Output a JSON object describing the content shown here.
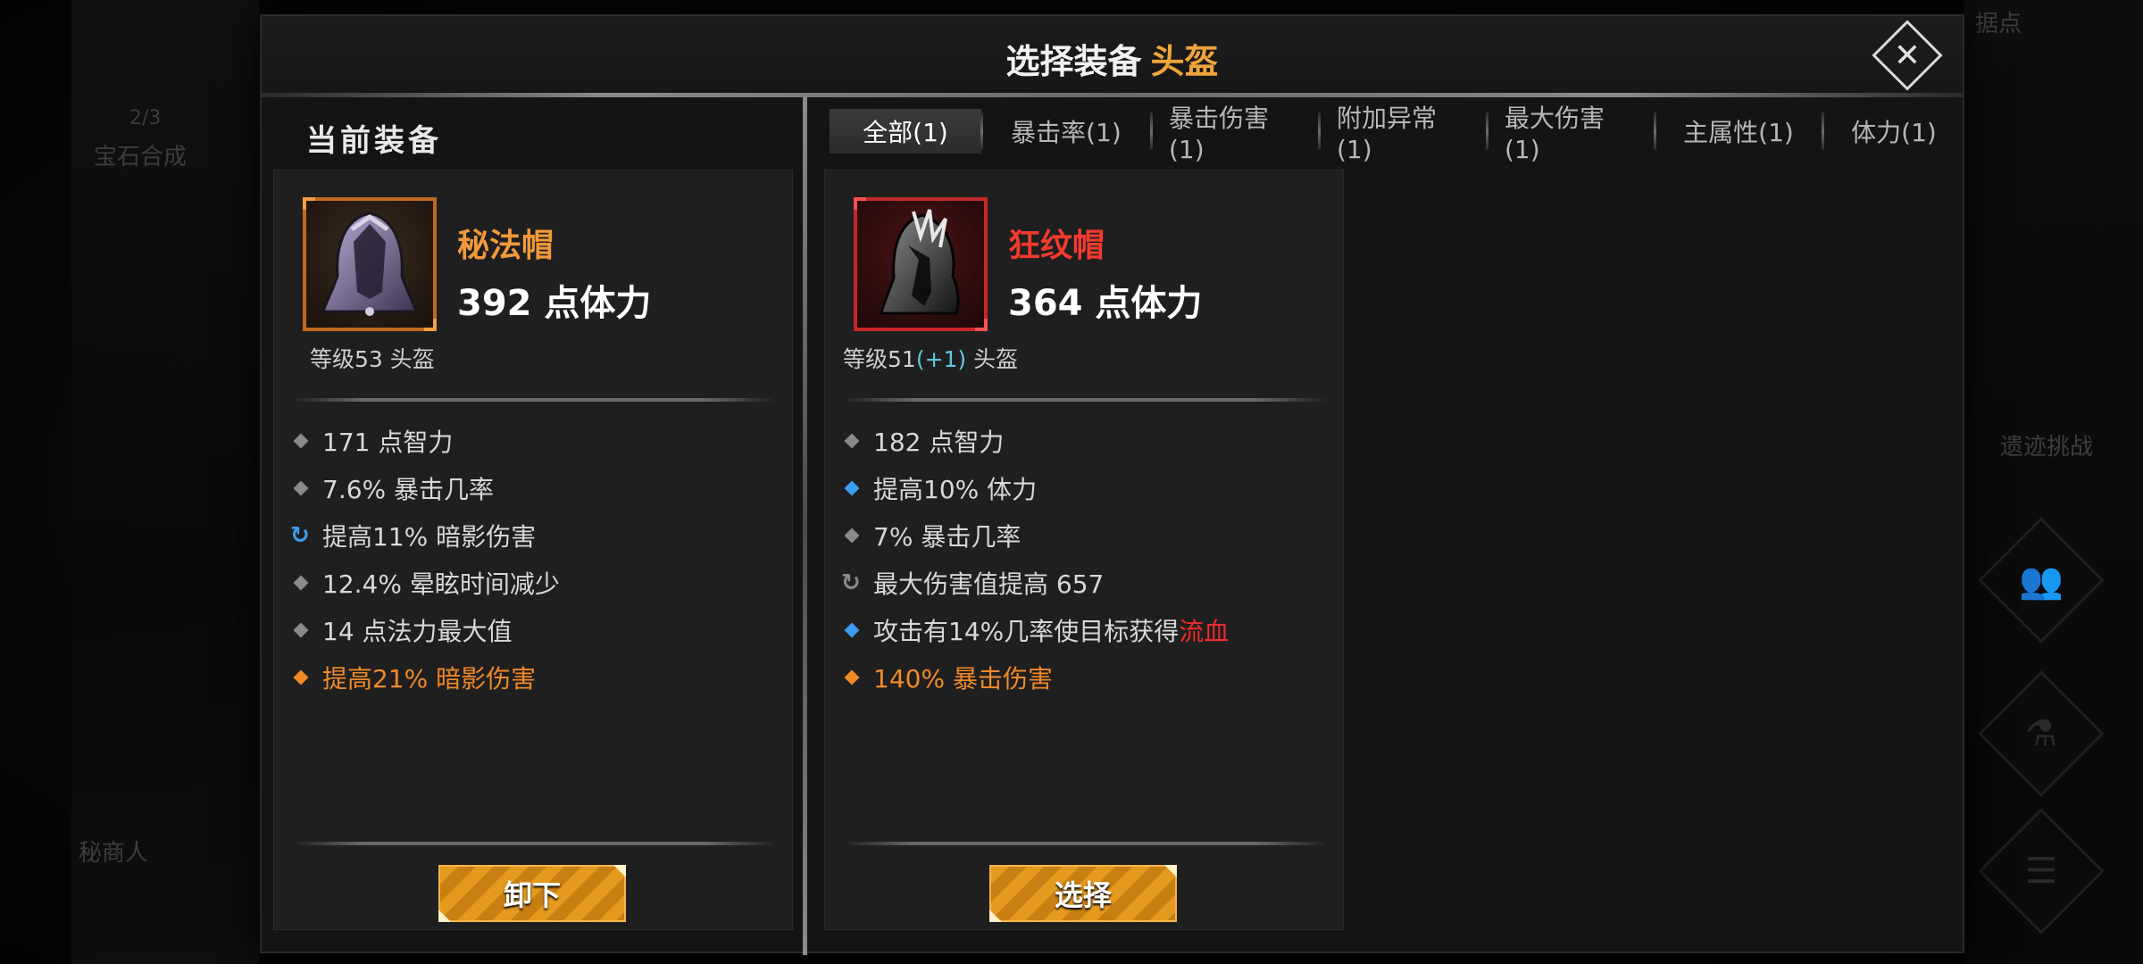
{
  "background": {
    "gem_count": "2/3",
    "gem_label": "宝石合成",
    "merchant_label": "秘商人",
    "ranking_label": "据点",
    "fight_label": "遗迹挑战"
  },
  "dialog": {
    "title": "选择装备",
    "title_slot": "头盔",
    "close_symbol": "✕"
  },
  "current": {
    "section_title": "当前装备",
    "name": "秘法帽",
    "main_stat": "392 点体力",
    "level_text": "等级53 头盔",
    "stats": [
      {
        "bullet": "gray",
        "text": "171 点智力",
        "style": "normal"
      },
      {
        "bullet": "gray",
        "text": "7.6% 暴击几率",
        "style": "normal"
      },
      {
        "bullet": "cycle-blue",
        "text": "提高11% 暗影伤害",
        "style": "normal"
      },
      {
        "bullet": "gray",
        "text": "12.4% 晕眩时间减少",
        "style": "normal"
      },
      {
        "bullet": "gray",
        "text": "14 点法力最大值",
        "style": "normal"
      },
      {
        "bullet": "orange",
        "text": "提高21% 暗影伤害",
        "style": "legend"
      }
    ],
    "button_label": "卸下"
  },
  "tabs": [
    {
      "label": "全部(1)",
      "active": true
    },
    {
      "label": "暴击率(1)",
      "active": false
    },
    {
      "label": "暴击伤害(1)",
      "active": false
    },
    {
      "label": "附加异常(1)",
      "active": false
    },
    {
      "label": "最大伤害(1)",
      "active": false
    },
    {
      "label": "主属性(1)",
      "active": false
    },
    {
      "label": "体力(1)",
      "active": false
    }
  ],
  "candidate": {
    "name": "狂纹帽",
    "main_stat": "364 点体力",
    "level_prefix": "等级51",
    "level_bonus": "(+1)",
    "level_suffix": " 头盔",
    "stats": [
      {
        "bullet": "gray",
        "text": "182 点智力",
        "style": "normal"
      },
      {
        "bullet": "blue",
        "text": "提高10% 体力",
        "style": "normal"
      },
      {
        "bullet": "gray",
        "text": "7% 暴击几率",
        "style": "normal"
      },
      {
        "bullet": "cycle-gray",
        "text": "最大伤害值提高 657",
        "style": "normal"
      },
      {
        "bullet": "blue",
        "text": "攻击有14%几率使目标获得",
        "highlight": "流血",
        "style": "normal"
      },
      {
        "bullet": "orange",
        "text": "140% 暴击伤害",
        "style": "legend"
      }
    ],
    "button_label": "选择"
  },
  "colors": {
    "accent_orange": "#f0a53a",
    "legendary_orange": "#f08a28",
    "rare_red": "#f23a2e",
    "bonus_cyan": "#5ec8e0",
    "affix_blue": "#3b9cf0"
  }
}
